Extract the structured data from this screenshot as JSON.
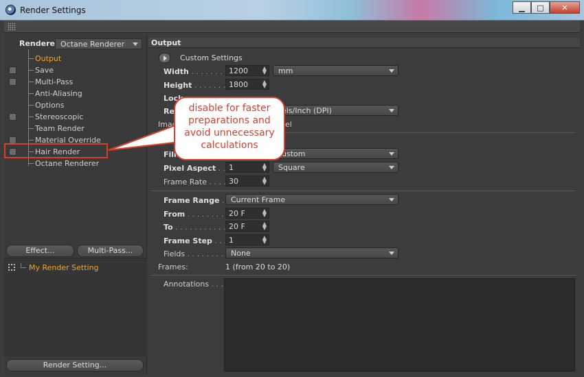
{
  "window": {
    "title": "Render Settings",
    "controls": {
      "minimize": "▁",
      "maximize": "□",
      "close": "✕"
    }
  },
  "renderer": {
    "label": "Renderer",
    "value": "Octane Renderer"
  },
  "tree": [
    {
      "label": "Output",
      "has_check": false,
      "active": true
    },
    {
      "label": "Save",
      "has_check": true,
      "active": false
    },
    {
      "label": "Multi-Pass",
      "has_check": true,
      "active": false
    },
    {
      "label": "Anti-Aliasing",
      "has_check": false,
      "active": false
    },
    {
      "label": "Options",
      "has_check": false,
      "active": false
    },
    {
      "label": "Stereoscopic",
      "has_check": true,
      "active": false
    },
    {
      "label": "Team Render",
      "has_check": false,
      "active": false
    },
    {
      "label": "Material Override",
      "has_check": true,
      "active": false
    },
    {
      "label": "Hair Render",
      "has_check": true,
      "active": false
    },
    {
      "label": "Octane Renderer",
      "has_check": false,
      "active": false
    }
  ],
  "left_buttons": {
    "effect": "Effect...",
    "multipass": "Multi-Pass...",
    "render_setting": "Render Setting..."
  },
  "settings_list": {
    "item": "My Render Setting"
  },
  "output": {
    "header": "Output",
    "custom_settings": "Custom Settings",
    "width": {
      "label": "Width",
      "dots": " . . . . . . . . .",
      "value": "1200",
      "unit": "mm"
    },
    "height": {
      "label": "Height",
      "dots": " . . . . . . . .",
      "value": "1800"
    },
    "lock_label": "Lock",
    "resolution": {
      "label": "Re",
      "unit": "els/Inch (DPI)"
    },
    "image_label": "Imag",
    "image_suffix": "el",
    "film": {
      "label": "Film",
      "value": "ustom"
    },
    "pixel_aspect": {
      "label": "Pixel Aspect",
      "dots": " . . .",
      "value": "1",
      "select": "Square"
    },
    "frame_rate": {
      "label": "Frame Rate",
      "dots": " . . . . .",
      "value": "30"
    },
    "frame_range": {
      "label": "Frame Range",
      "dots": " . .",
      "value": "Current Frame"
    },
    "from": {
      "label": "From",
      "dots": " . . . . . . . . . . .",
      "value": "20 F"
    },
    "to": {
      "label": "To",
      "dots": " . . . . . . . . . . . .",
      "value": "20 F"
    },
    "frame_step": {
      "label": "Frame Step",
      "dots": " . . . .",
      "value": "1"
    },
    "fields": {
      "label": "Fields",
      "dots": " . . . . . . . . .",
      "value": "None"
    },
    "frames": {
      "label": "Frames:",
      "value": "1 (from 20 to 20)"
    },
    "annotations": {
      "label": "Annotations",
      "dots": " . . ."
    }
  },
  "callout": {
    "text": "disable for faster preparations and avoid unnecessary calculations"
  },
  "colors": {
    "accent_orange": "#f0a62a",
    "callout_red": "#d9402b",
    "panel_bg": "#3c3c3c"
  }
}
